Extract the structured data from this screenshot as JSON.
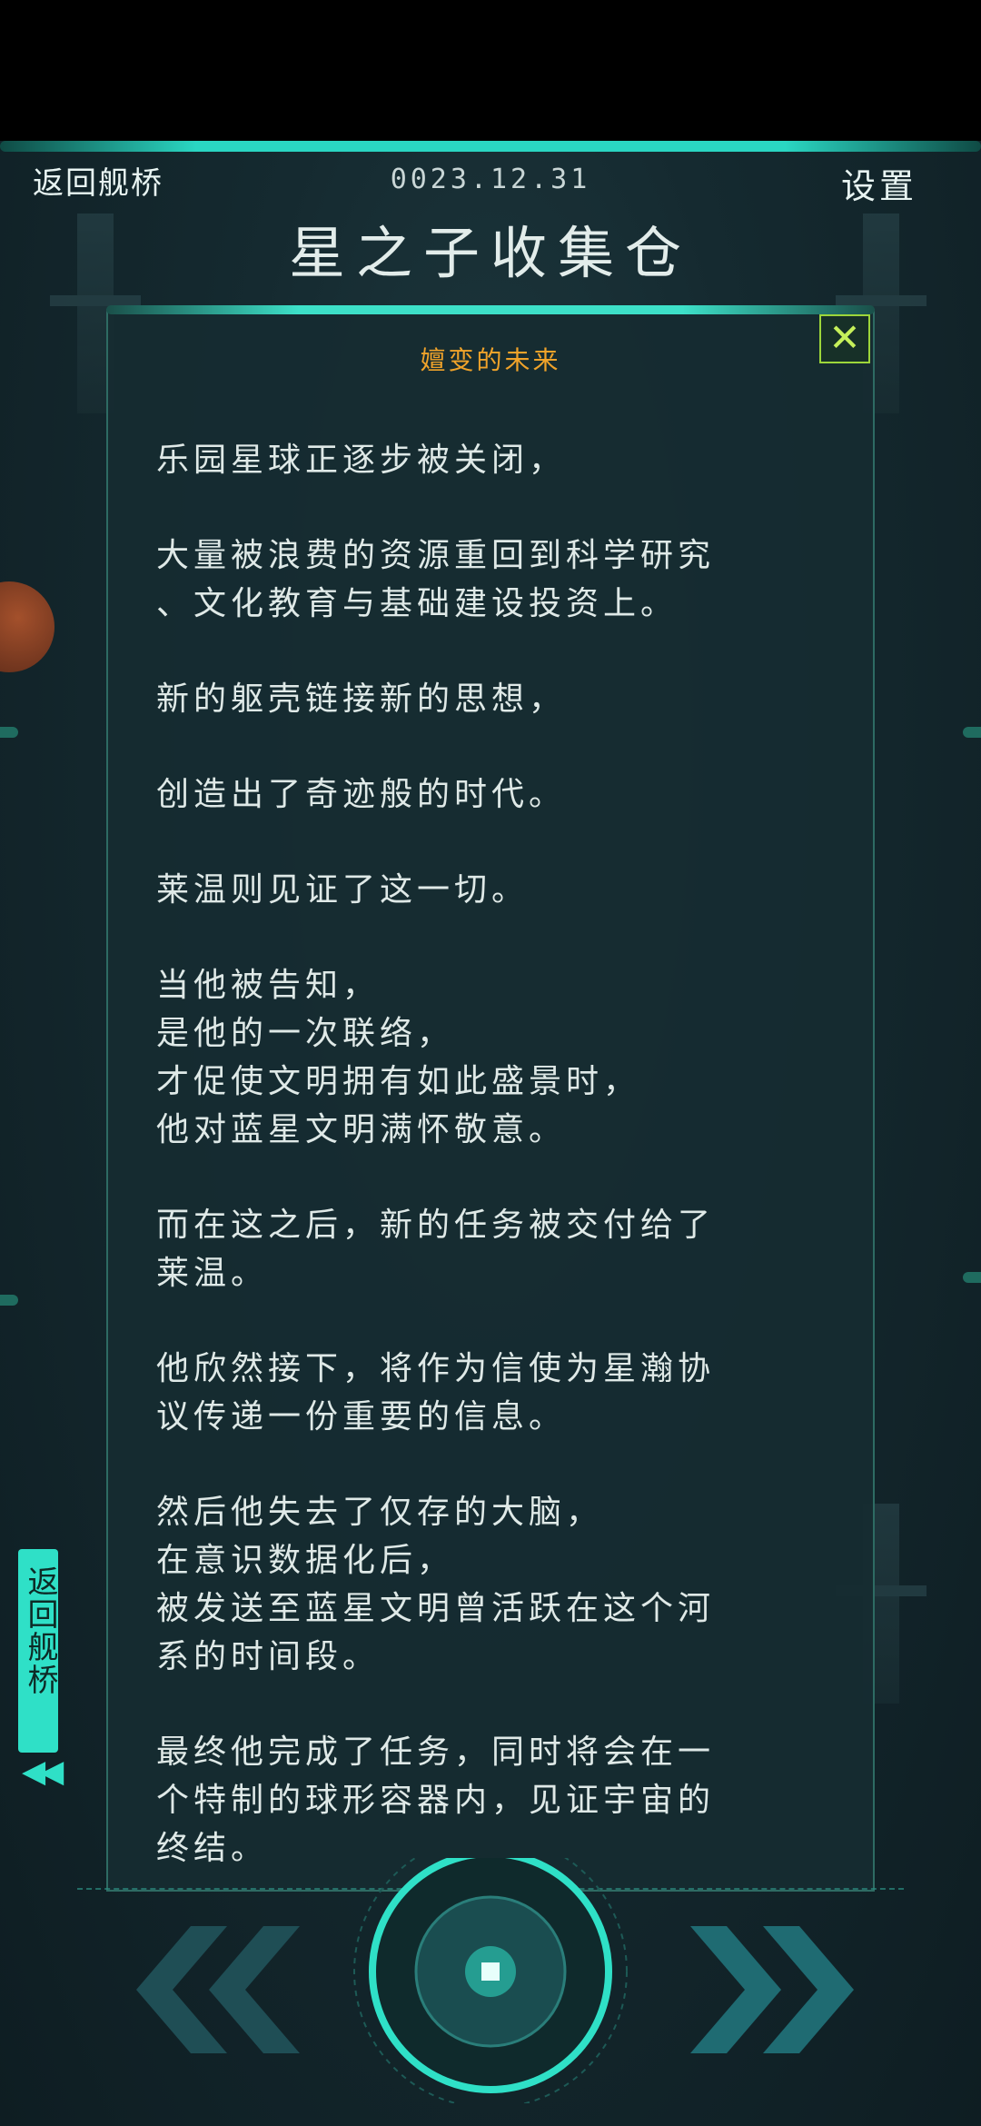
{
  "header": {
    "back_label": "返回舰桥",
    "date": "0023.12.31",
    "settings_label": "设置",
    "title": "星之子收集仓"
  },
  "panel": {
    "close_label": "✕",
    "story_title": "嬗变的未来",
    "paragraphs": [
      "乐园星球正逐步被关闭，",
      "大量被浪费的资源重回到科学研究\n、文化教育与基础建设投资上。",
      "新的躯壳链接新的思想，",
      "创造出了奇迹般的时代。",
      "莱温则见证了这一切。",
      "当他被告知，\n是他的一次联络，\n才促使文明拥有如此盛景时，\n他对蓝星文明满怀敬意。",
      "而在这之后，新的任务被交付给了\n莱温。",
      "他欣然接下，将作为信使为星瀚协\n议传递一份重要的信息。",
      "然后他失去了仅存的大脑，\n在意识数据化后，\n被发送至蓝星文明曾活跃在这个河\n系的时间段。",
      "最终他完成了任务，同时将会在一\n个特制的球形容器内，见证宇宙的\n终结。"
    ]
  },
  "side_tab": {
    "label": "返回舰桥",
    "arrows": "◀◀"
  },
  "colors": {
    "accent": "#2fe0c7",
    "title_orange": "#f0a32a",
    "close_green": "#9dd63a",
    "panel_bg": "#162c31"
  },
  "icons": {
    "close": "close-icon",
    "prev": "double-chevron-left-icon",
    "next": "double-chevron-right-icon",
    "center": "dial-button-icon"
  }
}
